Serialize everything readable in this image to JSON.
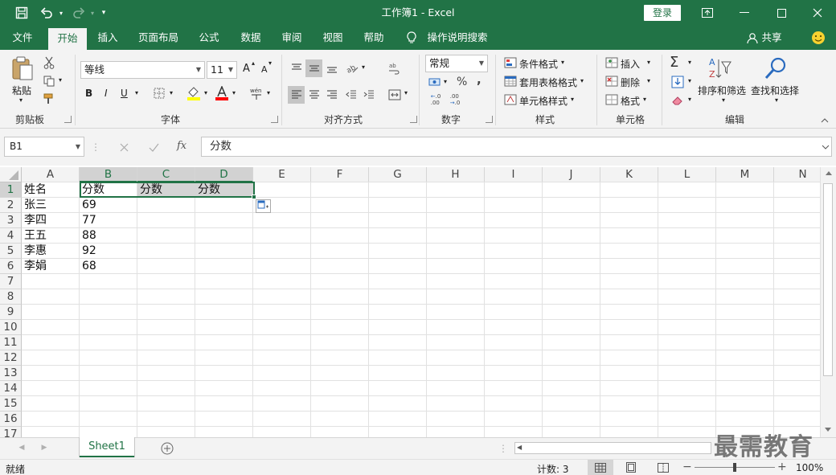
{
  "title_bar": {
    "title": "工作簿1  -  Excel",
    "login": "登录",
    "quick_access": {
      "save": "save-icon",
      "undo": "undo-icon",
      "redo": "redo-icon",
      "customize": "customize-icon"
    }
  },
  "tabs": [
    "文件",
    "开始",
    "插入",
    "页面布局",
    "公式",
    "数据",
    "审阅",
    "视图",
    "帮助"
  ],
  "active_tab": "开始",
  "tell_me": "操作说明搜索",
  "share": "共享",
  "ribbon": {
    "clipboard": {
      "label": "剪贴板",
      "paste": "粘贴"
    },
    "font": {
      "label": "字体",
      "font_name": "等线",
      "font_size": "11",
      "bold": "B",
      "italic": "I",
      "underline": "U",
      "grow": "A",
      "shrink": "A",
      "fill_color": "#ffff00",
      "font_color": "#ff0000"
    },
    "alignment": {
      "label": "对齐方式"
    },
    "number": {
      "label": "数字",
      "format": "常规",
      "percent": "%",
      "comma": ",",
      "inc_decimal": ".00",
      "dec_decimal": ".0"
    },
    "styles": {
      "label": "样式",
      "conditional": "条件格式",
      "table": "套用表格格式",
      "cell_styles": "单元格样式"
    },
    "cells": {
      "label": "单元格",
      "insert": "插入",
      "delete": "删除",
      "format": "格式"
    },
    "editing": {
      "label": "编辑",
      "sum": "Σ",
      "sort_filter": "排序和筛选",
      "find_select": "查找和选择"
    }
  },
  "formula_bar": {
    "name_box": "B1",
    "fx": "fx",
    "value": "分数"
  },
  "columns": [
    "A",
    "B",
    "C",
    "D",
    "E",
    "F",
    "G",
    "H",
    "I",
    "J",
    "K",
    "L",
    "M",
    "N"
  ],
  "rows": [
    "1",
    "2",
    "3",
    "4",
    "5",
    "6",
    "7",
    "8",
    "9",
    "10",
    "11",
    "12",
    "13",
    "14",
    "15",
    "16",
    "17"
  ],
  "cells": {
    "A1": "姓名",
    "B1": "分数",
    "C1": "分数",
    "D1": "分数",
    "A2": "张三",
    "B2": "69",
    "A3": "李四",
    "B3": "77",
    "A4": "王五",
    "B4": "88",
    "A5": "李惠",
    "B5": "92",
    "A6": "李娟",
    "B6": "68"
  },
  "sheet_tabs": [
    "Sheet1"
  ],
  "status_bar": {
    "ready": "就绪",
    "count": "计数: 3",
    "zoom": "100%",
    "zoom_level": 1.0
  },
  "watermark": "最需教育",
  "colors": {
    "accent": "#217346",
    "selection_fill": "#d4d4d4"
  }
}
